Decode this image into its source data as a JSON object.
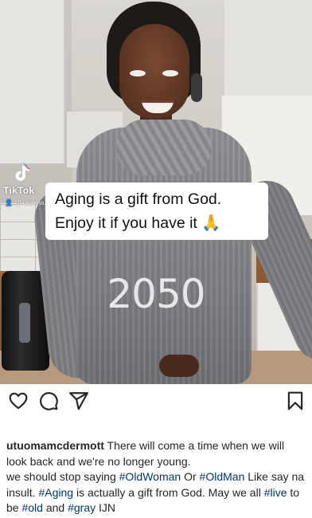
{
  "media": {
    "watermark": {
      "brand": "TikTok",
      "handle": "@ utuoma..."
    },
    "caption_overlay": {
      "line1": "Aging is a gift from God.",
      "line2": "Enjoy it if you have it 🙏"
    },
    "year_text": "2050"
  },
  "actions": {
    "like_icon": "heart-outline",
    "comment_icon": "speech-bubble-outline",
    "share_icon": "paper-plane-outline",
    "save_icon": "bookmark-outline"
  },
  "post": {
    "username": "utuomamcdermott",
    "text_1": " There will come a time when we will look back and we're no longer young.",
    "text_2": " we should stop saying ",
    "tag_oldwoman": "#OldWoman",
    "text_3": " Or ",
    "tag_oldman": "#OldMan",
    "text_4": " Like say na insult. ",
    "tag_aging": "#Aging",
    "text_5": " is actually a gift from God. May we all ",
    "tag_live": "#live",
    "text_6": " to be ",
    "tag_old": "#old",
    "text_7": " and ",
    "tag_gray": "#gray",
    "text_8": " IJN"
  },
  "colors": {
    "hashtag": "#00376b",
    "text": "#262626"
  }
}
